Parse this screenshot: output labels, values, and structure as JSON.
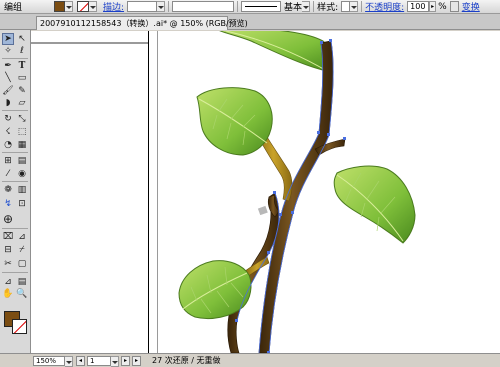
{
  "control_bar": {
    "selection_label": "编组",
    "fill_color": "#7b4d12",
    "stroke_link": "描边:",
    "stroke_profile": "基本",
    "style_label": "样式:",
    "opacity_link": "不透明度:",
    "opacity_value": "100",
    "opacity_unit": "%",
    "transform_link": "变换"
  },
  "document_tab": {
    "title": "2007910112158543（转换）.ai* @ 150% (RGB/预览)"
  },
  "toolbox": {
    "tools": [
      "selection-tool",
      "direct-selection-tool",
      "magic-wand-tool",
      "lasso-tool",
      "pen-tool",
      "type-tool",
      "line-tool",
      "rectangle-tool",
      "paintbrush-tool",
      "pencil-tool",
      "blob-brush-tool",
      "eraser-tool",
      "rotate-tool",
      "scale-tool",
      "warp-tool",
      "free-transform-tool",
      "symbol-sprayer-tool",
      "column-graph-tool",
      "mesh-tool",
      "gradient-tool",
      "eyedropper-tool",
      "blend-tool",
      "live-paint-bucket-tool",
      "live-paint-selection-tool",
      "crop-area-tool",
      "slice-tool",
      "hand-tool",
      "zoom-tool"
    ],
    "fill_swatch": "#7b4d12",
    "stroke_swatch": "none"
  },
  "status_bar": {
    "zoom": "150%",
    "page": "1",
    "status": "27 次还原 / 无重做"
  },
  "colors": {
    "accent": "#1a3fc8",
    "leaf_green": "#7fbf3a",
    "stem_brown": "#5a3a12",
    "path_selection": "#4a6ee0"
  }
}
